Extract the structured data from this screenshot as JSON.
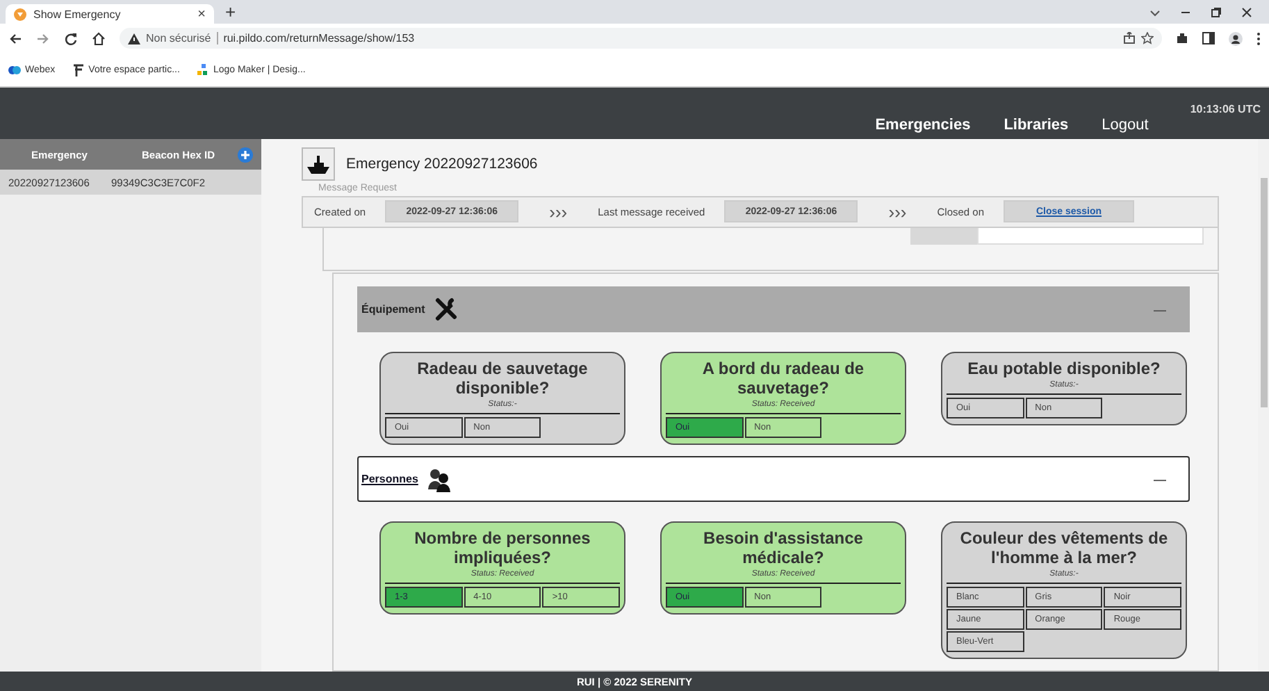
{
  "browser": {
    "tab": {
      "title": "Show Emergency",
      "close": "×"
    },
    "new_tab": "+",
    "security": "Non sécurisé",
    "url": "rui.pildo.com/returnMessage/show/153",
    "bookmarks": [
      {
        "label": "Webex"
      },
      {
        "label": "Votre espace partic..."
      },
      {
        "label": "Logo Maker | Desig..."
      }
    ]
  },
  "header": {
    "nav": [
      {
        "label": "Emergencies",
        "selected": true
      },
      {
        "label": "Libraries",
        "selected": true
      },
      {
        "label": "Logout",
        "selected": false
      }
    ],
    "clock": "10:13:06 UTC"
  },
  "sidebar": {
    "columns": [
      "Emergency",
      "Beacon Hex ID"
    ],
    "rows": [
      {
        "cells": [
          "20220927123606",
          "99349C3C3E7C0F2"
        ],
        "selected": true
      }
    ]
  },
  "emergency": {
    "title": "Emergency 20220927123606",
    "subtitle": "Message Request",
    "timeline": [
      {
        "label": "Created on",
        "value": "2022-09-27 12:36:06",
        "kind": "value"
      },
      {
        "label": "Last message received",
        "value": "2022-09-27 12:36:06",
        "kind": "value"
      },
      {
        "label": "Closed on",
        "value": "Close session",
        "kind": "link"
      }
    ],
    "separator": "›››"
  },
  "sections": [
    {
      "title": "Équipement",
      "kind": "tools",
      "highlighted": true,
      "toggle": "—",
      "cards": [
        {
          "question": "Radeau de sauvetage disponible?",
          "status": "Status:-",
          "received": false,
          "options": [
            {
              "label": "Oui",
              "selected": false
            },
            {
              "label": "Non",
              "selected": false
            }
          ]
        },
        {
          "question": "A bord du radeau de sauvetage?",
          "status": "Status: Received",
          "received": true,
          "options": [
            {
              "label": "Oui",
              "selected": true
            },
            {
              "label": "Non",
              "selected": false
            }
          ]
        },
        {
          "question": "Eau potable disponible?",
          "status": "Status:-",
          "received": false,
          "options": [
            {
              "label": "Oui",
              "selected": false
            },
            {
              "label": "Non",
              "selected": false
            }
          ]
        }
      ]
    },
    {
      "title": "Personnes",
      "kind": "people",
      "highlighted": false,
      "toggle": "—",
      "cards": [
        {
          "question": "Nombre de personnes impliquées?",
          "status": "Status: Received",
          "received": true,
          "options": [
            {
              "label": "1-3",
              "selected": true
            },
            {
              "label": "4-10",
              "selected": false
            },
            {
              "label": ">10",
              "selected": false
            }
          ]
        },
        {
          "question": "Besoin d'assistance médicale?",
          "status": "Status: Received",
          "received": true,
          "options": [
            {
              "label": "Oui",
              "selected": true
            },
            {
              "label": "Non",
              "selected": false
            }
          ]
        },
        {
          "question": "Couleur des vêtements de l'homme à la mer?",
          "status": "Status:-",
          "received": false,
          "options": [
            {
              "label": "Blanc",
              "selected": false
            },
            {
              "label": "Gris",
              "selected": false
            },
            {
              "label": "Noir",
              "selected": false
            },
            {
              "label": "Jaune",
              "selected": false
            },
            {
              "label": "Orange",
              "selected": false
            },
            {
              "label": "Rouge",
              "selected": false
            },
            {
              "label": "Bleu-Vert",
              "selected": false
            }
          ]
        }
      ]
    }
  ],
  "footer": "RUI | © 2022 SERENITY"
}
